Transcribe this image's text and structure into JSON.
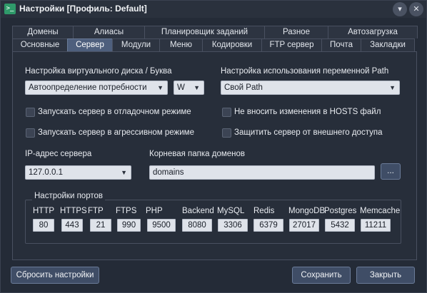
{
  "window": {
    "title": "Настройки [Профиль: Default]",
    "app_icon": ">_",
    "minimize_glyph": "▾",
    "close_glyph": "✕"
  },
  "tabs": {
    "top_row": [
      "Домены",
      "Алиасы",
      "Планировщик заданий",
      "Разное",
      "Автозагрузка"
    ],
    "bottom_row": [
      "Основные",
      "Сервер",
      "Модули",
      "Меню",
      "Кодировки",
      "FTP сервер",
      "Почта",
      "Закладки"
    ],
    "active": "Сервер"
  },
  "server": {
    "vdisk_label": "Настройка виртуального диска / Буква",
    "vdisk_value": "Автоопределение потребности",
    "drive_letter": "W",
    "path_label": "Настройка использования переменной Path",
    "path_value": "Свой Path",
    "debug_mode_label": "Запускать сервер в отладочном режиме",
    "aggressive_mode_label": "Запускать сервер в агрессивном режиме",
    "no_hosts_label": "Не вносить изменения в HOSTS файл",
    "protect_label": "Защитить сервер от внешнего доступа",
    "ip_label": "IP-адрес сервера",
    "ip_value": "127.0.0.1",
    "root_label": "Корневая папка доменов",
    "root_value": "domains",
    "browse_label": "..."
  },
  "ports": {
    "group_title": "Настройки портов",
    "items": [
      {
        "label": "HTTP",
        "value": "80"
      },
      {
        "label": "HTTPS",
        "value": "443"
      },
      {
        "label": "FTP",
        "value": "21"
      },
      {
        "label": "FTPS",
        "value": "990"
      },
      {
        "label": "PHP",
        "value": "9500"
      },
      {
        "label": "Backend",
        "value": "8080"
      },
      {
        "label": "MySQL",
        "value": "3306"
      },
      {
        "label": "Redis",
        "value": "6379"
      },
      {
        "label": "MongoDB",
        "value": "27017"
      },
      {
        "label": "Postgres",
        "value": "5432"
      },
      {
        "label": "Memcache",
        "value": "11211"
      }
    ]
  },
  "buttons": {
    "reset": "Сбросить настройки",
    "save": "Сохранить",
    "close": "Закрыть"
  },
  "colors": {
    "background": "#242b37",
    "active_tab": "#4e5f7d",
    "button": "#3f4d66",
    "field": "#dfe3ea"
  }
}
